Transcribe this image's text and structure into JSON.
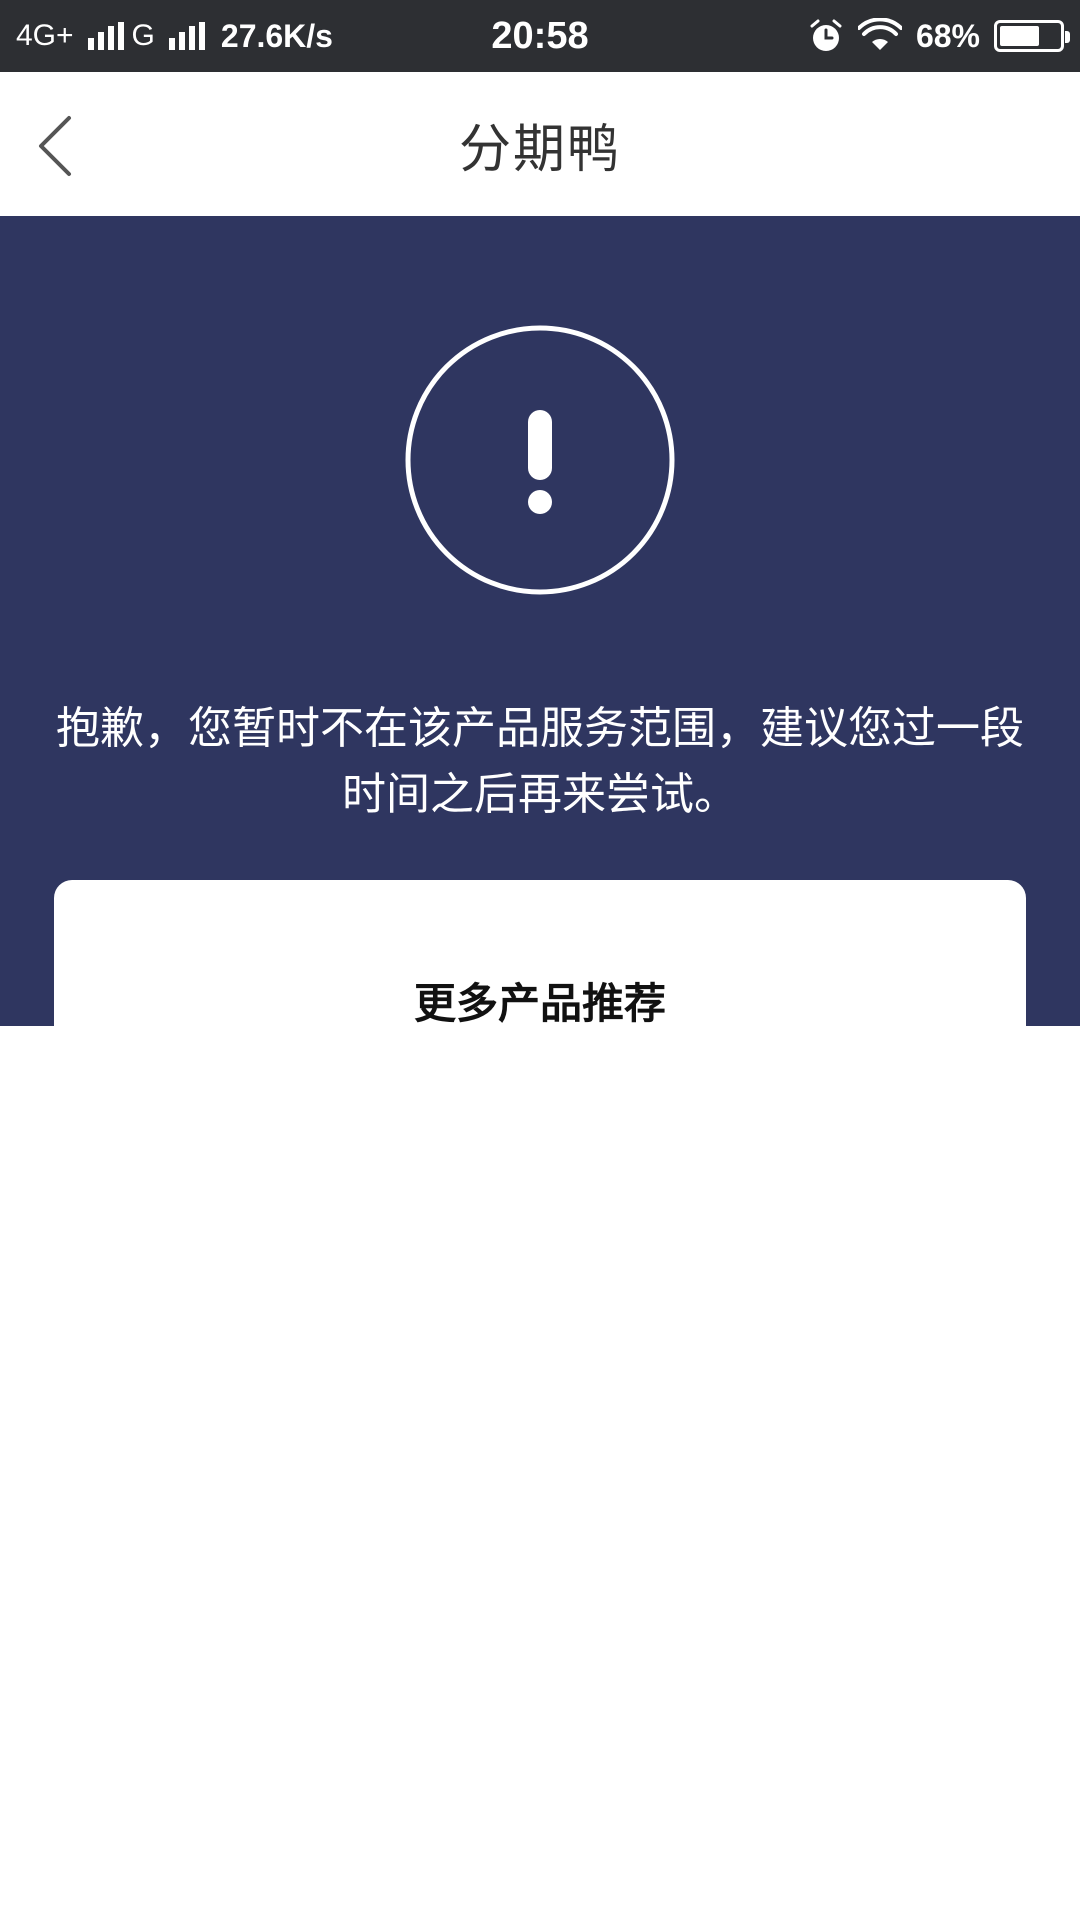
{
  "status_bar": {
    "network1": "4G+",
    "network2": "G",
    "speed": "27.6K/s",
    "time": "20:58",
    "battery": "68%",
    "battery_level": 0.68,
    "icons": [
      "signal-icon",
      "alarm-icon",
      "wifi-icon",
      "battery-icon"
    ]
  },
  "header": {
    "title": "分期鸭",
    "back_icon": "chevron-left-icon"
  },
  "hero": {
    "icon": "alert-circle-icon",
    "message": "抱歉，您暂时不在该产品服务范围，建议您过一段时间之后再来尝试。",
    "background": "#2f3660"
  },
  "card": {
    "title": "更多产品推荐"
  }
}
